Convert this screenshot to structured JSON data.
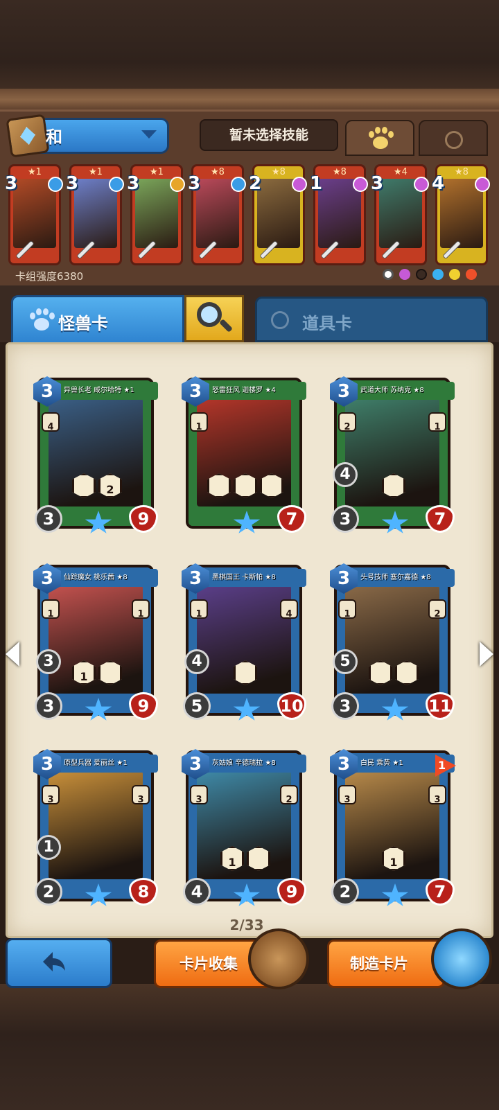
{
  "deck": {
    "name": "和",
    "skill_status": "暂未选择技能",
    "strength_label": "卡组强度6380"
  },
  "deck_cards": [
    {
      "stars": "★1",
      "cost": "3",
      "gem_color": "#3a9ce6",
      "border": "#c23c22",
      "art": "#b14a26"
    },
    {
      "stars": "★1",
      "cost": "3",
      "gem_color": "#3a9ce6",
      "border": "#c23c22",
      "art": "#6d7fc9"
    },
    {
      "stars": "★1",
      "cost": "3",
      "gem_color": "#e7a52a",
      "border": "#c23c22",
      "art": "#7aa55a"
    },
    {
      "stars": "★8",
      "cost": "3",
      "gem_color": "#3a9ce6",
      "border": "#c23c22",
      "art": "#b9495a"
    },
    {
      "stars": "★8",
      "cost": "2",
      "gem_color": "#c85ad6",
      "border": "#d8b320",
      "art": "#8a6a3e"
    },
    {
      "stars": "★8",
      "cost": "1",
      "gem_color": "#c85ad6",
      "border": "#c23c22",
      "art": "#6a3e8a"
    },
    {
      "stars": "★4",
      "cost": "3",
      "gem_color": "#c85ad6",
      "border": "#c23c22",
      "art": "#3f7a6a"
    },
    {
      "stars": "★8",
      "cost": "4",
      "gem_color": "#c85ad6",
      "border": "#d8b320",
      "art": "#b0702c"
    }
  ],
  "tabs": {
    "monster": "怪兽卡",
    "item": "道具卡"
  },
  "cards": [
    {
      "title": "异兽长老 威尔哈特 ★1",
      "cost": "3",
      "atk": "3",
      "hp": "9",
      "extra": "",
      "side_left": "4",
      "side_right": "",
      "frame": "#2f7a3a",
      "art": "#3a5f86",
      "skills": 2,
      "skill_labels": [
        "",
        "2"
      ]
    },
    {
      "title": "怒雷狂风 迦楼罗 ★4",
      "cost": "3",
      "atk": "",
      "hp": "7",
      "extra": "",
      "side_left": "1",
      "side_right": "",
      "frame": "#2f7a3a",
      "art": "#b5362a",
      "skills": 3,
      "skill_labels": [
        "",
        "",
        ""
      ]
    },
    {
      "title": "武道大师 苏纳克 ★8",
      "cost": "3",
      "atk": "3",
      "hp": "7",
      "extra": "4",
      "side_left": "2",
      "side_right": "1",
      "frame": "#2f7a3a",
      "art": "#3f7f6a",
      "skills": 1,
      "skill_labels": [
        ""
      ]
    },
    {
      "title": "仙踪魔女 桃乐茜 ★8",
      "cost": "3",
      "atk": "3",
      "hp": "9",
      "extra": "3",
      "side_left": "1",
      "side_right": "1",
      "frame": "#2b6aa8",
      "art": "#c4524f",
      "skills": 2,
      "skill_labels": [
        "1",
        ""
      ]
    },
    {
      "title": "黑棋国王 卡斯帕 ★8",
      "cost": "3",
      "atk": "5",
      "hp": "10",
      "extra": "4",
      "side_left": "1",
      "side_right": "4",
      "frame": "#2b6aa8",
      "art": "#5b3f8a",
      "skills": 1,
      "skill_labels": [
        ""
      ]
    },
    {
      "title": "头号技师 塞尔嘉德 ★8",
      "cost": "3",
      "atk": "3",
      "hp": "11",
      "extra": "5",
      "side_left": "1",
      "side_right": "2",
      "frame": "#2b6aa8",
      "art": "#8a6a48",
      "skills": 2,
      "skill_labels": [
        "",
        ""
      ]
    },
    {
      "title": "原型兵器 爱丽丝 ★1",
      "cost": "3",
      "atk": "2",
      "hp": "8",
      "extra": "1",
      "side_left": "3",
      "side_right": "3",
      "frame": "#2b6aa8",
      "art": "#c9903a",
      "skills": 0,
      "skill_labels": []
    },
    {
      "title": "灰姑娘 辛德瑞拉 ★8",
      "cost": "3",
      "atk": "4",
      "hp": "9",
      "extra": "",
      "side_left": "3",
      "side_right": "2",
      "frame": "#2b6aa8",
      "art": "#3f8aa8",
      "skills": 2,
      "skill_labels": [
        "1",
        ""
      ]
    },
    {
      "title": "白民 乘黄 ★1",
      "cost": "3",
      "atk": "2",
      "hp": "7",
      "extra": "",
      "side_left": "3",
      "side_right": "3",
      "frame": "#2b6aa8",
      "art": "#b88a4a",
      "skills": 1,
      "skill_labels": [
        "1"
      ],
      "flag": "1"
    }
  ],
  "pagination": "2/33",
  "buttons": {
    "collection": "卡片收集",
    "craft": "制造卡片"
  }
}
